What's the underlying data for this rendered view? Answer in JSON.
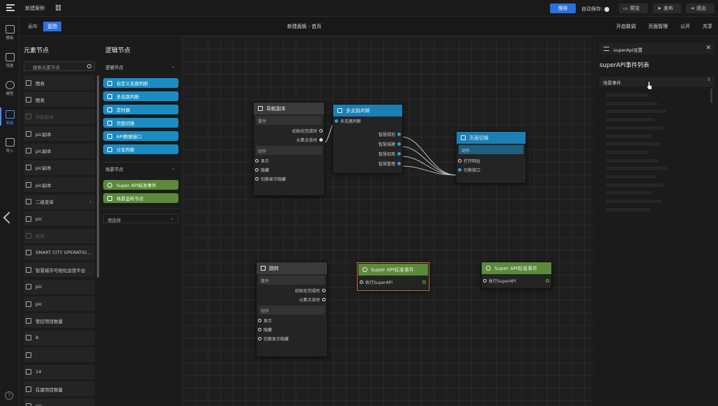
{
  "topbar": {
    "project": "新建案例",
    "save": "保存",
    "autosave": "自动保存:",
    "preview": "预览",
    "publish": "发布",
    "logout": "退出"
  },
  "subbar": {
    "tabs": [
      "画布",
      "蓝图"
    ],
    "active_tab": "蓝图",
    "page_title": "新建面板 - 首页",
    "links": [
      "开启联调",
      "页面管理",
      "公开",
      "共享"
    ]
  },
  "rail": [
    "模板",
    "场景",
    "模型",
    "面板",
    "导入"
  ],
  "elements": {
    "title": "元素节点",
    "search_placeholder": "搜索元素节点",
    "items": [
      {
        "label": "图表",
        "dim": false
      },
      {
        "label": "图表",
        "dim": false
      },
      {
        "label": "导航副本",
        "dim": true
      },
      {
        "label": "pic副本",
        "dim": false
      },
      {
        "label": "pic副本",
        "dim": false
      },
      {
        "label": "pic副本",
        "dim": false
      },
      {
        "label": "pic副本",
        "dim": false
      },
      {
        "label": "二级菜单",
        "dim": false,
        "arrow": true
      },
      {
        "label": "pic",
        "dim": false
      },
      {
        "label": "跳转",
        "dim": true
      },
      {
        "label": "SMART CITY OPERATIO...",
        "dim": false
      },
      {
        "label": "智慧城市可视化运营平台",
        "dim": false
      },
      {
        "label": "pic",
        "dim": false
      },
      {
        "label": "pic",
        "dim": false
      },
      {
        "label": "管控项目数量",
        "dim": false
      },
      {
        "label": "8",
        "dim": false
      },
      {
        "label": "",
        "dim": false
      },
      {
        "label": "14",
        "dim": false
      },
      {
        "label": "在建项目数量",
        "dim": false
      },
      {
        "label": "pic",
        "dim": false
      }
    ]
  },
  "logic": {
    "title": "逻辑节点",
    "section1": "逻辑节点",
    "buttons": [
      "自定义支路判断",
      "多支路判断",
      "定时器",
      "页面切换",
      "API数据接口",
      "分支判断"
    ],
    "section2": "场景节点",
    "scene_buttons": [
      "Super API标准事件",
      "场景监听节点"
    ],
    "select": "请选择"
  },
  "nodes": {
    "nav": {
      "title": "导航副本",
      "events": "事件",
      "e1": "初始化完成时",
      "e2": "元素点击时",
      "actions": "动作",
      "a1": "显示",
      "a2": "隐藏",
      "a3": "切换显示隐藏"
    },
    "multi": {
      "title": "多支路判断",
      "in": "多支路判断",
      "o1": "智慧规划",
      "o2": "智慧城建",
      "o3": "智慧招商",
      "o4": "智慧管理"
    },
    "page": {
      "title": "页面切换",
      "actions": "动作",
      "a1": "打开网址",
      "a2": "切换接口"
    },
    "jump": {
      "title": "跳转",
      "events": "事件",
      "e1": "初始化完成时",
      "e2": "元素点击时",
      "actions": "动作",
      "a1": "显示",
      "a2": "隐藏",
      "a3": "切换显示隐藏"
    },
    "api1": {
      "title": "Super API标准事件",
      "in": "执行SuperAPI"
    },
    "api2": {
      "title": "Super API标准事件",
      "in": "执行SuperAPI"
    }
  },
  "right": {
    "header": "superApi设置",
    "title": "superAPI事件列表",
    "select": "场景事件"
  },
  "colors": {
    "accent": "#2d6fe0",
    "node_blue": "#1a7fb5",
    "node_green": "#5a8a3a",
    "port": "#2aa0e0"
  }
}
